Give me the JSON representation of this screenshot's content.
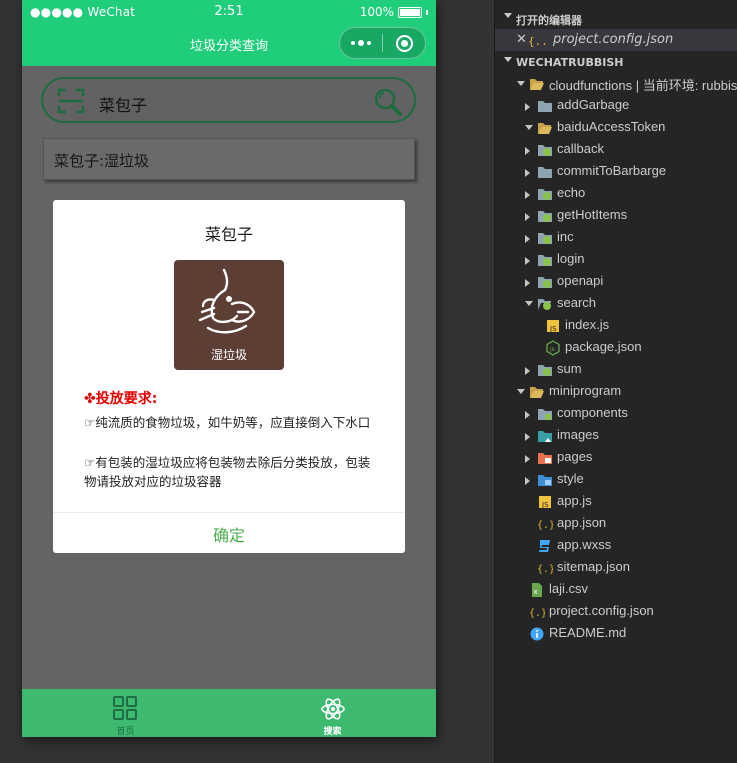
{
  "simulator": {
    "status_bar": {
      "carrier": "●●●●● WeChat",
      "time": "2:51",
      "battery": "100%"
    },
    "navbar": {
      "title": "垃圾分类查询"
    },
    "search": {
      "value": "菜包子"
    },
    "result": {
      "text": "菜包子:湿垃圾"
    },
    "modal": {
      "title": "菜包子",
      "category": "湿垃圾",
      "requirements_heading": "✤投放要求:",
      "requirements": [
        "☞纯流质的食物垃圾，如牛奶等，应直接倒入下水口",
        "☞有包装的湿垃圾应将包装物去除后分类投放，包装物请投放对应的垃圾容器"
      ],
      "confirm_label": "确定"
    },
    "tabbar": {
      "home_label": "首页",
      "search_label": "搜索"
    }
  },
  "explorer": {
    "open_editors_header": "打开的编辑器",
    "open_editors": [
      {
        "close_glyph": "✕",
        "name": "project.config.json",
        "icon": "json-icon"
      }
    ],
    "project_header": "WECHATRUBBISH",
    "tree": [
      {
        "label": "cloudfunctions | 当前环境: rubbis",
        "icon": "folder-open-icon",
        "expanded": true
      },
      {
        "label": "addGarbage",
        "icon": "folder-icon",
        "expanded": false
      },
      {
        "label": "baiduAccessToken",
        "icon": "folder-open-icon",
        "expanded": true
      },
      {
        "label": "callback",
        "icon": "cloud-folder-icon",
        "expanded": false
      },
      {
        "label": "commitToBarbarge",
        "icon": "folder-icon",
        "expanded": false
      },
      {
        "label": "echo",
        "icon": "cloud-folder-icon",
        "expanded": false
      },
      {
        "label": "getHotItems",
        "icon": "cloud-folder-icon",
        "expanded": false
      },
      {
        "label": "inc",
        "icon": "cloud-folder-icon",
        "expanded": false
      },
      {
        "label": "login",
        "icon": "cloud-folder-icon",
        "expanded": false
      },
      {
        "label": "openapi",
        "icon": "cloud-folder-icon",
        "expanded": false
      },
      {
        "label": "search",
        "icon": "cloud-folder-open-icon",
        "expanded": true
      },
      {
        "label": "index.js",
        "icon": "js-icon"
      },
      {
        "label": "package.json",
        "icon": "node-icon"
      },
      {
        "label": "sum",
        "icon": "cloud-folder-icon",
        "expanded": false
      },
      {
        "label": "miniprogram",
        "icon": "folder-open-icon",
        "expanded": true
      },
      {
        "label": "components",
        "icon": "components-folder-icon",
        "expanded": false
      },
      {
        "label": "images",
        "icon": "images-folder-icon",
        "expanded": false
      },
      {
        "label": "pages",
        "icon": "pages-folder-icon",
        "expanded": false
      },
      {
        "label": "style",
        "icon": "style-folder-icon",
        "expanded": false
      },
      {
        "label": "app.js",
        "icon": "js-icon"
      },
      {
        "label": "app.json",
        "icon": "json-icon"
      },
      {
        "label": "app.wxss",
        "icon": "css-icon"
      },
      {
        "label": "sitemap.json",
        "icon": "json-icon"
      },
      {
        "label": "laji.csv",
        "icon": "csv-icon"
      },
      {
        "label": "project.config.json",
        "icon": "json-icon"
      },
      {
        "label": "README.md",
        "icon": "info-icon"
      }
    ]
  },
  "colors": {
    "wechat_green": "#1fcd7b",
    "tabbar_green": "#3db970",
    "confirm_green": "#4cae4f",
    "requirement_red": "#e50000",
    "tile_brown": "#5c3e34",
    "explorer_bg": "#252526"
  }
}
